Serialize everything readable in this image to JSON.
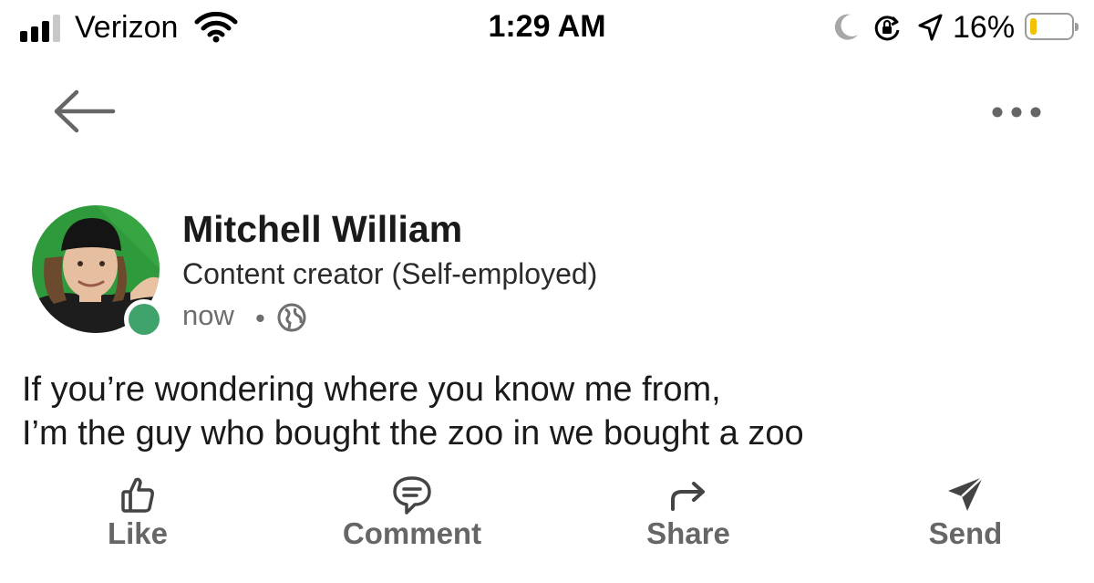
{
  "status_bar": {
    "carrier": "Verizon",
    "time": "1:29 AM",
    "battery_percent": "16%",
    "battery_level": 0.16,
    "battery_color": "#f2c200",
    "icons": [
      "signal-icon",
      "wifi-icon",
      "moon-icon",
      "rotation-lock-icon",
      "location-arrow-icon",
      "battery-icon"
    ]
  },
  "nav": {
    "icons": [
      "back-arrow-icon",
      "more-options-icon"
    ]
  },
  "post": {
    "author": {
      "name": "Mitchell William",
      "headline": "Content creator (Self-employed)",
      "timestamp": "now",
      "separator": "•",
      "visibility_icon": "globe-icon",
      "presence_color": "#3fa36b"
    },
    "text_lines": [
      "If you’re wondering where you know me from,",
      "I’m the guy who bought the zoo in we bought a zoo"
    ]
  },
  "actions": [
    {
      "label": "Like",
      "icon": "thumbs-up-icon"
    },
    {
      "label": "Comment",
      "icon": "comment-icon"
    },
    {
      "label": "Share",
      "icon": "share-arrow-icon"
    },
    {
      "label": "Send",
      "icon": "send-icon"
    }
  ]
}
